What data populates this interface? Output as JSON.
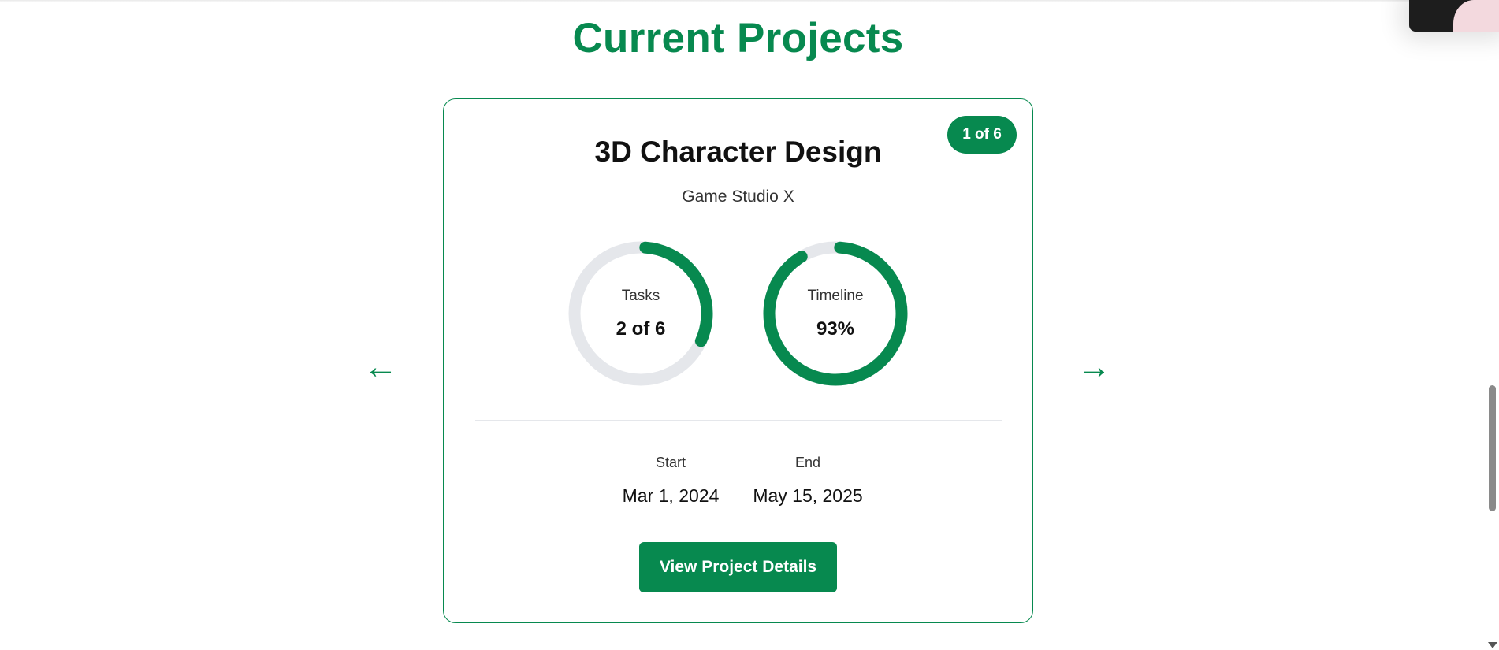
{
  "section": {
    "title": "Current Projects"
  },
  "carousel": {
    "prev_label": "←",
    "next_label": "→"
  },
  "project": {
    "counter": "1 of 6",
    "title": "3D Character Design",
    "client": "Game Studio X",
    "tasks": {
      "label": "Tasks",
      "value": "2 of 6",
      "completed": 2,
      "total": 6
    },
    "timeline": {
      "label": "Timeline",
      "value": "93%",
      "percent": 93
    },
    "start": {
      "label": "Start",
      "value": "Mar 1, 2024"
    },
    "end": {
      "label": "End",
      "value": "May 15, 2025"
    },
    "details_button": "View Project Details"
  },
  "colors": {
    "accent": "#07894f",
    "ring_track": "#e5e7eb"
  }
}
